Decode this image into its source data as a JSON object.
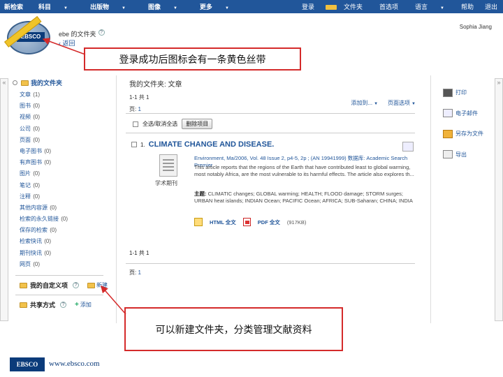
{
  "nav": {
    "left": [
      "新检索",
      "科目",
      "出版物",
      "图像",
      "更多"
    ],
    "right": [
      "登录",
      "文件夹",
      "首选项",
      "语言",
      "帮助",
      "退出"
    ]
  },
  "header": {
    "folder_title": "ebe 的文件夹",
    "back_link": "‹ 返回",
    "user": "Sophia Jiang",
    "logo_text": "EBSCO"
  },
  "callouts": {
    "top": "登录成功后图标会有一条黄色丝带",
    "bottom": "可以新建文件夹，分类管理文献资料"
  },
  "sidebar": {
    "header": "我的文件夹",
    "items": [
      {
        "label": "文章",
        "count": "(1)"
      },
      {
        "label": "图书",
        "count": "(0)"
      },
      {
        "label": "视频",
        "count": "(0)"
      },
      {
        "label": "公司",
        "count": "(0)"
      },
      {
        "label": "页面",
        "count": "(0)"
      },
      {
        "label": "电子图书",
        "count": "(0)"
      },
      {
        "label": "有声图书",
        "count": "(0)"
      },
      {
        "label": "图片",
        "count": "(0)"
      },
      {
        "label": "笔记",
        "count": "(0)"
      },
      {
        "label": "注释",
        "count": "(0)"
      },
      {
        "label": "其他内容源",
        "count": "(0)"
      },
      {
        "label": "检索的永久链接",
        "count": "(0)"
      },
      {
        "label": "保存的检索",
        "count": "(0)"
      },
      {
        "label": "检索快讯",
        "count": "(0)"
      },
      {
        "label": "期刊快讯",
        "count": "(0)"
      },
      {
        "label": "网页",
        "count": "(0)"
      }
    ],
    "custom_folders": "我的自定义项",
    "new_link": "新建",
    "shared_folders": "共享方式",
    "add_link": "添加"
  },
  "main": {
    "title": "我的文件夹: 文章",
    "range": "1-1 共 1",
    "page_label": "页:",
    "page_num": "1",
    "add_to": "添加到...",
    "page_options": "页面选项",
    "select_all": "全选/取消全选",
    "delete_button": "删除项目"
  },
  "result": {
    "num": "1.",
    "title": "CLIMATE CHANGE AND DISEASE.",
    "source": "Environment, Ma/2006, Vol. 48 Issue 2, p4-5, 2p ; (AN 19941999) 数据库: Academic Search Premier",
    "abstract": "This article reports that the regions of the Earth that have contributed least to global warming, most notably Africa, are the most vulnerable to its harmful effects. The article also explores th...",
    "subjects_label": "主题:",
    "subjects": "CLIMATIC changes; GLOBAL warming; HEALTH; FLOOD damage; STORM surges; URBAN heat islands; INDIAN Ocean; PACIFIC Ocean; AFRICA; SUB-Saharan; CHINA; INDIA",
    "doc_label": "学术期刊",
    "html_full": "HTML 全文",
    "pdf_full": "PDF 全文",
    "pdf_size": "(917KB)"
  },
  "bottom": {
    "range": "1-1 共 1",
    "page_label": "页:",
    "page_num": "1"
  },
  "tools": [
    {
      "label": "打印",
      "icon": "print-icon"
    },
    {
      "label": "电子邮件",
      "icon": "email-icon"
    },
    {
      "label": "另存为文件",
      "icon": "save-icon"
    },
    {
      "label": "导出",
      "icon": "export-icon"
    }
  ],
  "footer": {
    "logo": "EBSCO",
    "url": "www.ebsco.com"
  }
}
